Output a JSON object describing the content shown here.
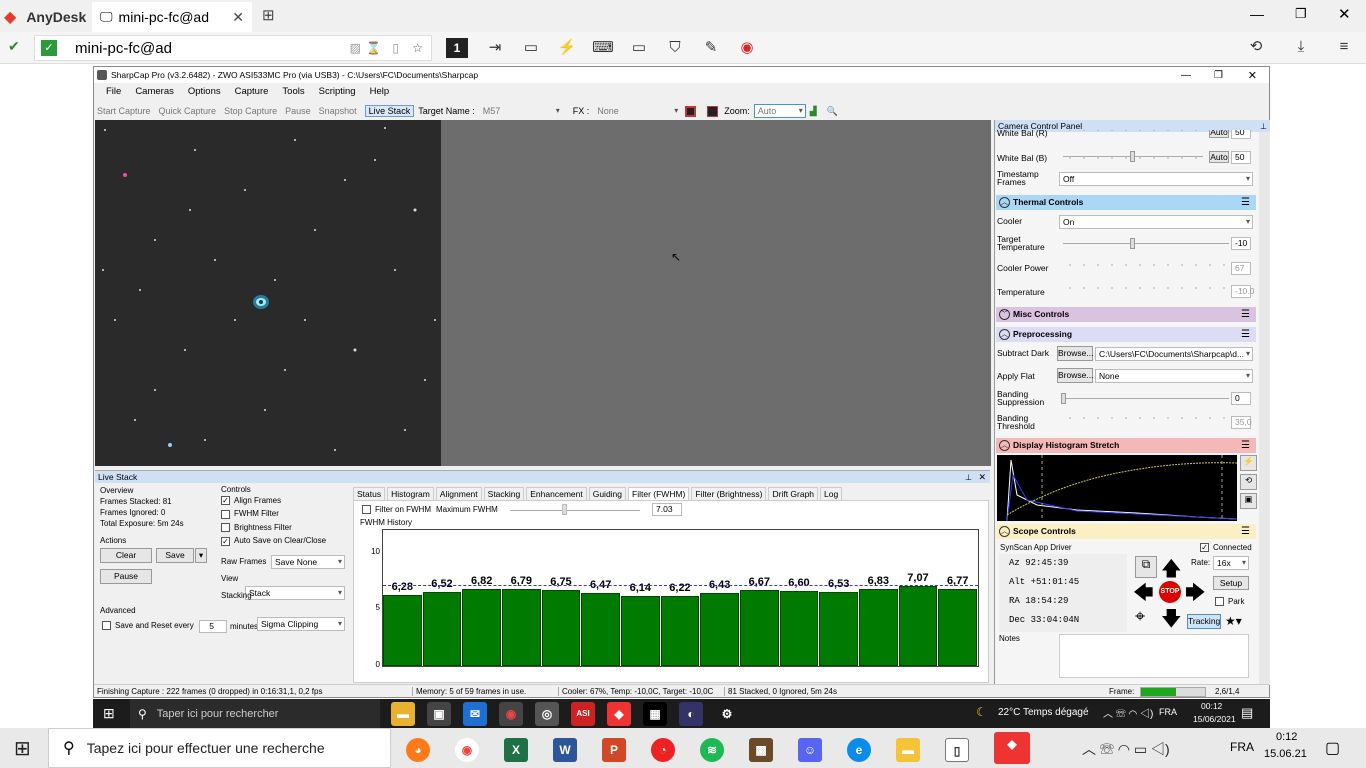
{
  "anydesk": {
    "app_name": "AnyDesk",
    "tab_label": "mini-pc-fc@ad",
    "address": "mini-pc-fc@ad",
    "monitor_number": "1"
  },
  "sharpcap": {
    "title": "SharpCap Pro (v3.2.6482) - ZWO ASI533MC Pro (via USB3) - C:\\Users\\FC\\Documents\\Sharpcap",
    "menu": [
      "File",
      "Cameras",
      "Options",
      "Capture",
      "Tools",
      "Scripting",
      "Help"
    ],
    "toolbar": {
      "start": "Start Capture",
      "quick": "Quick Capture",
      "stop": "Stop Capture",
      "pause": "Pause",
      "snapshot": "Snapshot",
      "live": "Live Stack",
      "target_label": "Target Name :",
      "target": "M57",
      "fx_label": "FX :",
      "fx": "None",
      "zoom_label": "Zoom:",
      "zoom": "Auto"
    },
    "ccp": {
      "title": "Camera Control Panel",
      "wb_r_label": "White Bal (R)",
      "wb_r": "50",
      "auto": "Auto",
      "wb_b_label": "White Bal (B)",
      "wb_b": "50",
      "timestamp_label": "Timestamp Frames",
      "timestamp": "Off",
      "thermal": "Thermal Controls",
      "cooler_label": "Cooler",
      "cooler": "On",
      "target_temp_label": "Target Temperature",
      "target_temp": "-10",
      "cooler_power_label": "Cooler Power",
      "cooler_power": "67",
      "temperature_label": "Temperature",
      "temperature": "-10.0",
      "misc": "Misc Controls",
      "pre": "Preprocessing",
      "dark_label": "Subtract Dark",
      "browse": "Browse...",
      "dark": "C:\\Users\\FC\\Documents\\Sharpcap\\d...",
      "flat_label": "Apply Flat",
      "flat": "None",
      "band_sup_label": "Banding Suppression",
      "band_sup": "0",
      "band_thr_label": "Banding Threshold",
      "band_thr": "35,0",
      "hist": "Display Histogram Stretch",
      "scope": "Scope Controls",
      "driver": "SynScan App Driver",
      "connected": "Connected",
      "az": "Az  92:45:39",
      "alt": "Alt +51:01:45",
      "ra": "RA  18:54:29",
      "dec": "Dec 33:04:04N",
      "rate_label": "Rate:",
      "rate": "16x",
      "setup": "Setup",
      "park": "Park",
      "tracking": "Tracking",
      "stop": "STOP",
      "notes": "Notes"
    },
    "live": {
      "title": "Live Stack",
      "overview": "Overview",
      "stacked": "Frames Stacked:  81",
      "ignored": "Frames Ignored:  0",
      "exposure": "Total Exposure:   5m 24s",
      "actions": "Actions",
      "clear": "Clear",
      "save": "Save",
      "pause": "Pause",
      "advanced": "Advanced",
      "save_reset": "Save and Reset every",
      "minutes": "5",
      "minutes_label": "minutes total exposure",
      "controls": "Controls",
      "align": "Align Frames",
      "fwhm": "FWHM Filter",
      "brightness": "Brightness Filter",
      "autosave": "Auto Save on Clear/Close",
      "raw_label": "Raw Frames",
      "raw": "Save None",
      "view_label": "View",
      "view": "Stack",
      "stacking_label": "Stacking",
      "stacking": "Sigma Clipping",
      "tabs": [
        "Status",
        "Histogram",
        "Alignment",
        "Stacking",
        "Enhancement",
        "Guiding",
        "Filter (FWHM)",
        "Filter (Brightness)",
        "Drift Graph",
        "Log"
      ],
      "filter_on": "Filter on FWHM",
      "max_label": "Maximum FWHM",
      "max": "7.03",
      "history": "FWHM History"
    },
    "status": {
      "finishing": "Finishing Capture : 222 frames (0 dropped) in 0:16:31,1, 0,2 fps",
      "memory": "Memory: 5 of 59 frames in use.",
      "cooler": "Cooler: 67%, Temp: -10,0C, Target: -10,0C",
      "stack": "81 Stacked, 0 Ignored, 5m 24s",
      "frame": "Frame:",
      "fps": "2,6/1,4"
    }
  },
  "chart_data": {
    "type": "bar",
    "title": "FWHM History",
    "ylim": [
      0,
      12
    ],
    "yticks": [
      "0",
      "5",
      "10"
    ],
    "threshold": 7.03,
    "values": [
      6.28,
      6.52,
      6.82,
      6.79,
      6.75,
      6.47,
      6.14,
      6.22,
      6.43,
      6.67,
      6.6,
      6.53,
      6.83,
      7.07,
      6.77
    ],
    "labels": [
      "6,28",
      "6,52",
      "6,82",
      "6,79",
      "6,75",
      "6,47",
      "6,14",
      "6,22",
      "6,43",
      "6,67",
      "6,60",
      "6,53",
      "6,83",
      "7,07",
      "6,77"
    ]
  },
  "inner_taskbar": {
    "search": "Taper ici pour rechercher",
    "weather": "22°C  Temps dégagé",
    "lang": "FRA",
    "time": "00:12",
    "date": "15/06/2021"
  },
  "outer_taskbar": {
    "search": "Tapez ici pour effectuer une recherche",
    "lang": "FRA",
    "time": "0:12",
    "date": "15.06.21"
  }
}
